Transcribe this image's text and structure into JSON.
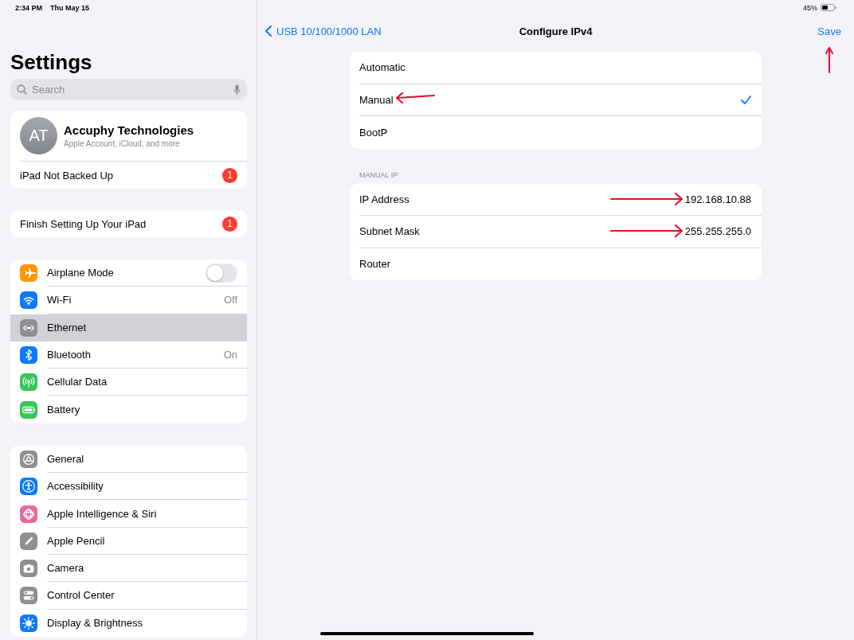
{
  "status_bar": {
    "time": "2:34 PM",
    "date": "Thu May 15",
    "battery": "45%"
  },
  "sidebar": {
    "title": "Settings",
    "search": {
      "placeholder": "Search"
    },
    "account": {
      "initials": "AT",
      "name": "Accuphy Technologies",
      "subtitle": "Apple Account, iCloud, and more",
      "alert": "iPad Not Backed Up",
      "badge": "1"
    },
    "setup": {
      "label": "Finish Setting Up Your iPad",
      "badge": "1"
    },
    "groups": [
      [
        {
          "kind": "toggle",
          "label": "Airplane Mode",
          "on": false,
          "selected": false,
          "color": "#ff9500"
        },
        {
          "kind": "value",
          "label": "Wi-Fi",
          "value": "Off",
          "selected": false,
          "color": "#0a7aff"
        },
        {
          "kind": "plain",
          "label": "Ethernet",
          "selected": true,
          "color": "#8e8e93"
        },
        {
          "kind": "value",
          "label": "Bluetooth",
          "value": "On",
          "selected": false,
          "color": "#0a7aff"
        },
        {
          "kind": "plain",
          "label": "Cellular Data",
          "selected": false,
          "color": "#34c759"
        },
        {
          "kind": "plain",
          "label": "Battery",
          "selected": false,
          "color": "#34c759"
        }
      ],
      [
        {
          "kind": "plain",
          "label": "General",
          "selected": false,
          "color": "#8e8e93"
        },
        {
          "kind": "plain",
          "label": "Accessibility",
          "selected": false,
          "color": "#0a7aff"
        },
        {
          "kind": "plain",
          "label": "Apple Intelligence & Siri",
          "selected": false,
          "color": "#e86a9a"
        },
        {
          "kind": "plain",
          "label": "Apple Pencil",
          "selected": false,
          "color": "#8e8e93"
        },
        {
          "kind": "plain",
          "label": "Camera",
          "selected": false,
          "color": "#8e8e93"
        },
        {
          "kind": "plain",
          "label": "Control Center",
          "selected": false,
          "color": "#8e8e93"
        },
        {
          "kind": "plain",
          "label": "Display & Brightness",
          "selected": false,
          "color": "#0a7aff"
        }
      ]
    ]
  },
  "detail": {
    "back": "USB 10/100/1000 LAN",
    "title": "Configure IPv4",
    "save": {
      "label": "Save",
      "marked": true
    },
    "options": [
      {
        "label": "Automatic",
        "selected": false,
        "marked": false
      },
      {
        "label": "Manual",
        "selected": true,
        "marked": true
      },
      {
        "label": "BootP",
        "selected": false,
        "marked": false
      }
    ],
    "section": "MANUAL IP",
    "fields": [
      {
        "label": "IP Address",
        "value": "192.168.10.88",
        "marked": true
      },
      {
        "label": "Subnet Mask",
        "value": "255.255.255.0",
        "marked": true
      },
      {
        "label": "Router",
        "marked": false
      }
    ]
  }
}
